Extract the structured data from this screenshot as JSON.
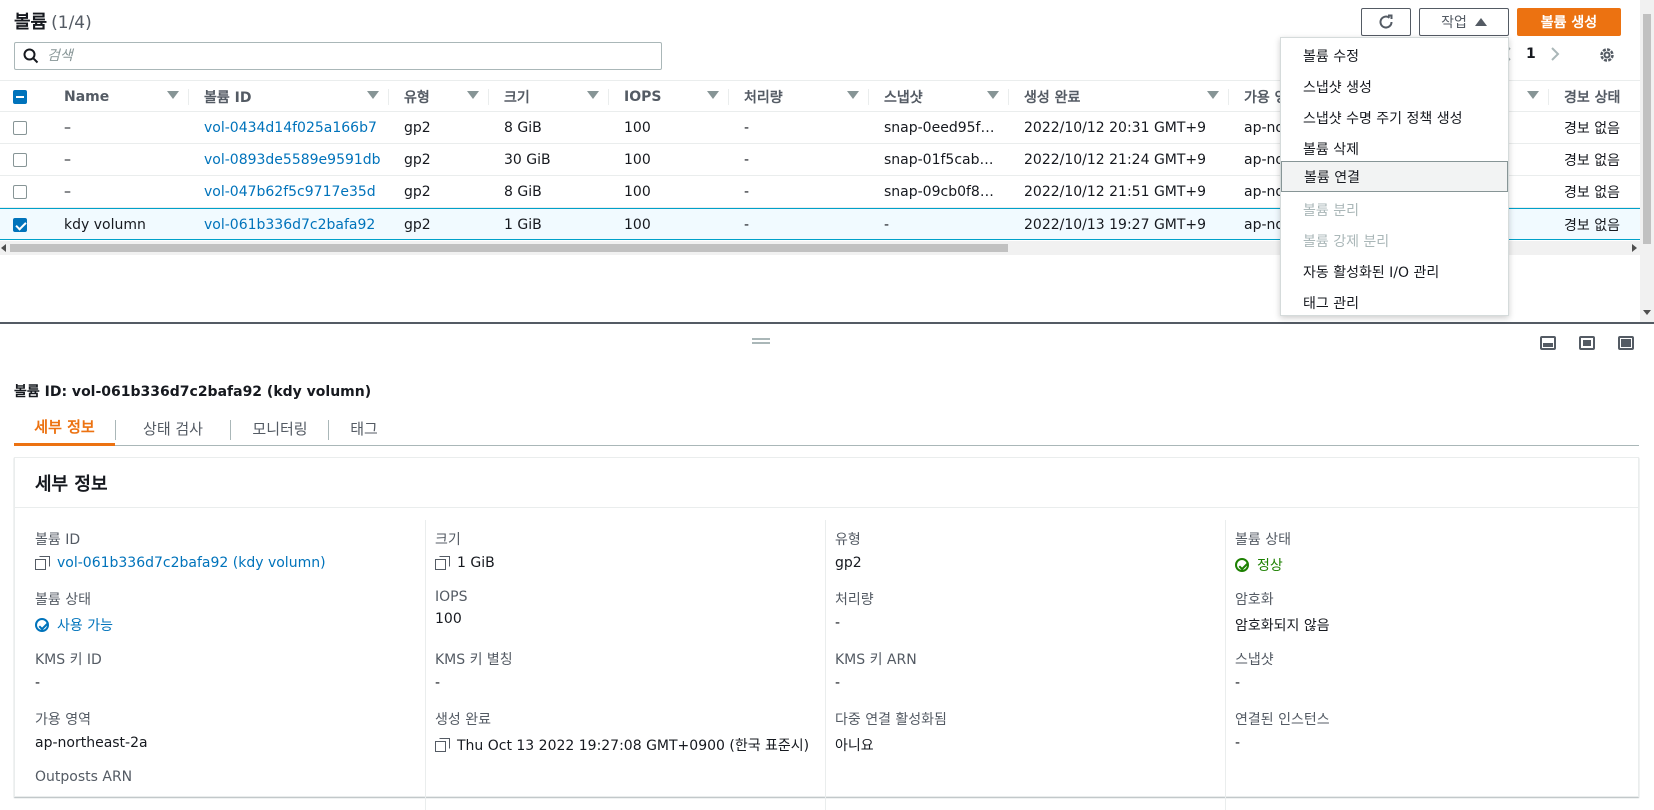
{
  "header": {
    "title": "볼륨",
    "count": "(1/4)",
    "search_placeholder": "검색",
    "actions_label": "작업",
    "create_label": "볼륨 생성",
    "page_number": "1"
  },
  "table": {
    "columns": [
      "Name",
      "볼륨 ID",
      "유형",
      "크기",
      "IOPS",
      "처리량",
      "스냅샷",
      "생성 완료",
      "가용 영",
      "경보 상태"
    ],
    "rows": [
      {
        "name": "–",
        "id": "vol-0434d14f025a166b7",
        "type": "gp2",
        "size": "8 GiB",
        "iops": "100",
        "throughput": "-",
        "snapshot": "snap-0eed95f…",
        "created": "2022/10/12 20:31 GMT+9",
        "az": "ap-no",
        "alarm": "경보 없음",
        "selected": false
      },
      {
        "name": "–",
        "id": "vol-0893de5589e9591db",
        "type": "gp2",
        "size": "30 GiB",
        "iops": "100",
        "throughput": "-",
        "snapshot": "snap-01f5cab…",
        "created": "2022/10/12 21:24 GMT+9",
        "az": "ap-no",
        "alarm": "경보 없음",
        "selected": false
      },
      {
        "name": "–",
        "id": "vol-047b62f5c9717e35d",
        "type": "gp2",
        "size": "8 GiB",
        "iops": "100",
        "throughput": "-",
        "snapshot": "snap-09cb0f8…",
        "created": "2022/10/12 21:51 GMT+9",
        "az": "ap-no",
        "alarm": "경보 없음",
        "selected": false
      },
      {
        "name": "kdy volumn",
        "id": "vol-061b336d7c2bafa92",
        "type": "gp2",
        "size": "1 GiB",
        "iops": "100",
        "throughput": "-",
        "snapshot": "-",
        "created": "2022/10/13 19:27 GMT+9",
        "az": "ap-no",
        "alarm": "경보 없음",
        "selected": true
      }
    ]
  },
  "menu": {
    "items": [
      {
        "label": "볼륨 수정",
        "disabled": false
      },
      {
        "label": "스냅샷 생성",
        "disabled": false
      },
      {
        "label": "스냅샷 수명 주기 정책 생성",
        "disabled": false
      },
      {
        "label": "볼륨 삭제",
        "disabled": false
      },
      {
        "label": "볼륨 연결",
        "disabled": false
      },
      {
        "label": "볼륨 분리",
        "disabled": true
      },
      {
        "label": "볼륨 강제 분리",
        "disabled": true
      },
      {
        "label": "자동 활성화된 I/O 관리",
        "disabled": false
      },
      {
        "label": "태그 관리",
        "disabled": false
      }
    ]
  },
  "detail": {
    "title": "볼륨 ID: vol-061b336d7c2bafa92 (kdy volumn)",
    "tabs": [
      "세부 정보",
      "상태 검사",
      "모니터링",
      "태그"
    ],
    "card_title": "세부 정보",
    "fields": {
      "volume_id_label": "볼륨 ID",
      "volume_id": "vol-061b336d7c2bafa92 (kdy volumn)",
      "volume_state_label": "볼륨 상태",
      "volume_state": "사용 가능",
      "kms_key_id_label": "KMS 키 ID",
      "kms_key_id": "-",
      "az_label": "가용 영역",
      "az": "ap-northeast-2a",
      "outposts_label": "Outposts ARN",
      "size_label": "크기",
      "size": "1 GiB",
      "iops_label": "IOPS",
      "iops": "100",
      "kms_alias_label": "KMS 키 별칭",
      "kms_alias": "-",
      "created_label": "생성 완료",
      "created": "Thu Oct 13 2022 19:27:08 GMT+0900 (한국 표준시)",
      "type_label": "유형",
      "type": "gp2",
      "throughput_label": "처리량",
      "throughput": "-",
      "kms_arn_label": "KMS 키 ARN",
      "kms_arn": "-",
      "multi_attach_label": "다중 연결 활성화됨",
      "multi_attach": "아니요",
      "status_label": "볼륨 상태",
      "status": "정상",
      "encryption_label": "암호화",
      "encryption": "암호화되지 않음",
      "snapshot_label": "스냅샷",
      "snapshot": "-",
      "attached_label": "연결된 인스턴스",
      "attached": "-"
    }
  }
}
